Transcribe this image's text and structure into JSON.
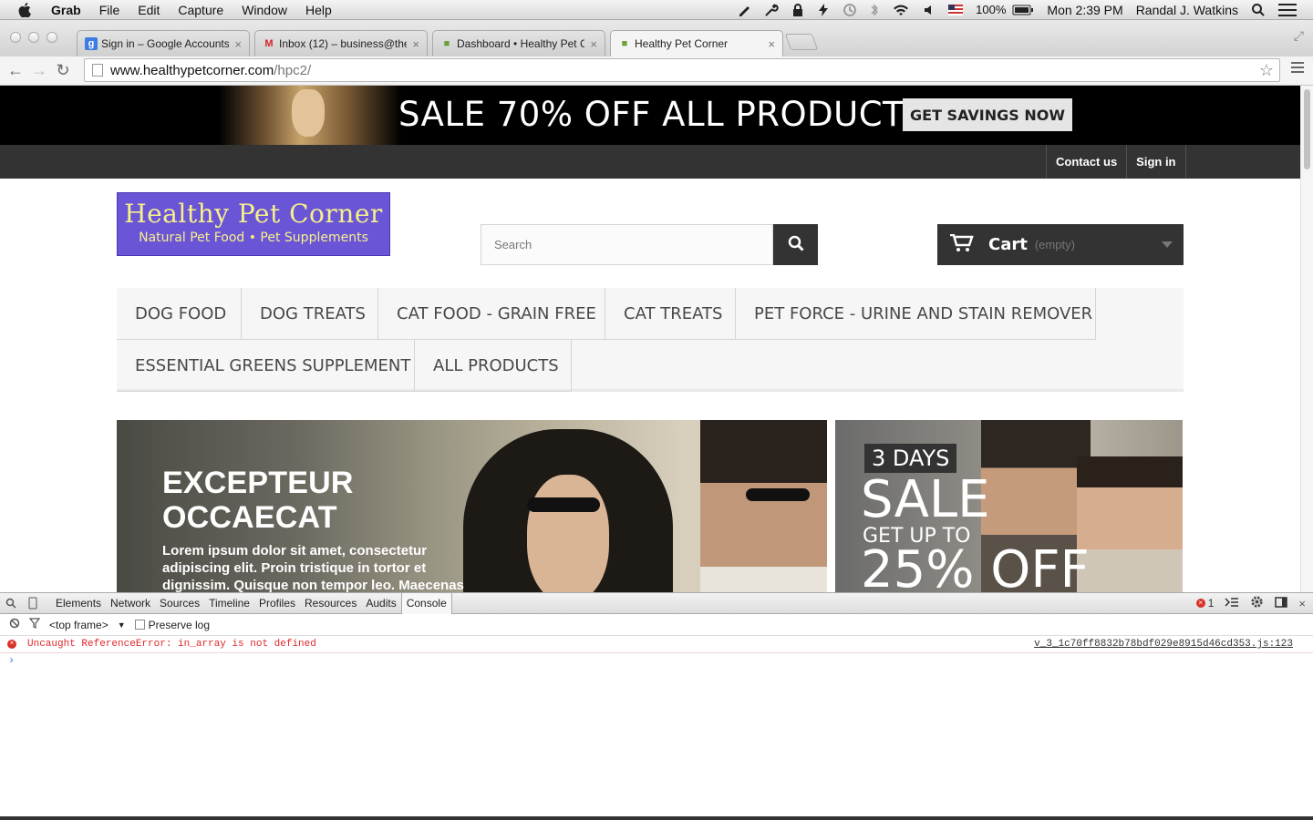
{
  "menubar": {
    "app": "Grab",
    "items": [
      "File",
      "Edit",
      "Capture",
      "Window",
      "Help"
    ],
    "battery": "100%",
    "clock": "Mon 2:39 PM",
    "user": "Randal J. Watkins"
  },
  "tabs": [
    {
      "title": "Sign in – Google Accounts",
      "icon": "google-icon"
    },
    {
      "title": "Inbox (12) – business@the",
      "icon": "gmail-icon"
    },
    {
      "title": "Dashboard • Healthy Pet C",
      "icon": "shopify-icon"
    },
    {
      "title": "Healthy Pet Corner",
      "icon": "shopify-icon",
      "active": true
    }
  ],
  "address": {
    "host": "www.healthypetcorner.com",
    "path": "/hpc2/"
  },
  "promo": {
    "headline": "SALE 70% OFF ALL PRODUCTS",
    "button": "GET SAVINGS NOW"
  },
  "topnav": {
    "contact": "Contact us",
    "signin": "Sign in"
  },
  "logo": {
    "title": "Healthy Pet Corner",
    "subtitle": "Natural Pet Food  •  Pet Supplements"
  },
  "search": {
    "placeholder": "Search"
  },
  "cart": {
    "label": "Cart",
    "status": "(empty)"
  },
  "categories": [
    "DOG FOOD",
    "DOG TREATS",
    "CAT FOOD - GRAIN FREE",
    "CAT TREATS",
    "PET FORCE - URINE AND STAIN REMOVER",
    "ESSENTIAL GREENS SUPPLEMENT",
    "ALL PRODUCTS"
  ],
  "slider": {
    "heading_line1": "EXCEPTEUR",
    "heading_line2": "OCCAECAT",
    "body": "Lorem ipsum dolor sit amet, consectetur adipiscing elit. Proin tristique in tortor et dignissim. Quisque non tempor leo. Maecenas egestas sem elit"
  },
  "banner": {
    "days": "3 DAYS",
    "sale": "SALE",
    "getup": "GET UP TO",
    "off": "25% OFF"
  },
  "devtools": {
    "tabs": [
      "Elements",
      "Network",
      "Sources",
      "Timeline",
      "Profiles",
      "Resources",
      "Audits",
      "Console"
    ],
    "active_tab": "Console",
    "error_count": "1",
    "frame": "<top frame>",
    "preserve_log": "Preserve log",
    "error_message": "Uncaught ReferenceError: in_array is not defined",
    "error_source": "v_3_1c70ff8832b78bdf029e8915d46cd353.js:123",
    "prompt": "›"
  },
  "colors": {
    "logo_bg": "#6a55d6",
    "logo_text": "#f6f08b",
    "topnav_bg": "#333333",
    "error": "#e3282b"
  }
}
